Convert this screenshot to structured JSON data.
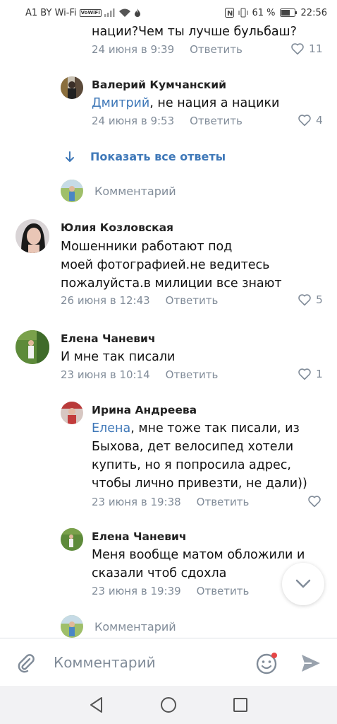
{
  "status_bar": {
    "carrier": "A1 BY Wi-Fi",
    "volte_badge": "VoWiFi",
    "battery": "61 %",
    "time": "22:56"
  },
  "comments": {
    "top_partial": {
      "text": "нации?Чем ты лучше бульбаш?",
      "date": "24 июня в 9:39",
      "reply": "Ответить",
      "likes": "11"
    },
    "valery": {
      "name": "Валерий Кумчанский",
      "mention": "Дмитрий",
      "text": ", не нация а нацики",
      "date": "24 июня в 9:53",
      "reply": "Ответить",
      "likes": "4"
    },
    "show_all": "Показать все ответы",
    "comment_placeholder_1": "Комментарий",
    "yulia": {
      "name": "Юлия Козловская",
      "lines": [
        "Мошенники работают под",
        "моей фотографией.не ведитесь",
        "пожалуйста.в милиции все знают"
      ],
      "date": "26 июня в 12:43",
      "reply": "Ответить",
      "likes": "5"
    },
    "elena1": {
      "name": "Елена Чаневич",
      "text": "И мне так писали",
      "date": "23 июня в 10:14",
      "reply": "Ответить",
      "likes": "1"
    },
    "irina": {
      "name": "Ирина Андреева",
      "mention": "Елена",
      "line1_rest": ", мне тоже так писали, из",
      "lines": [
        "Быхова, дет велосипед хотели",
        "купить, но я попросила адрес,",
        "чтобы лично привезти, не дали))"
      ],
      "date": "23 июня в 19:38",
      "reply": "Ответить"
    },
    "elena2": {
      "name": "Елена Чаневич",
      "lines": [
        "Меня вообще матом обложили и",
        "сказали чтоб сдохла"
      ],
      "date": "23 июня в 19:39",
      "reply": "Ответить"
    },
    "comment_placeholder_2": "Комментарий"
  },
  "composer": {
    "placeholder": "Комментарий"
  }
}
